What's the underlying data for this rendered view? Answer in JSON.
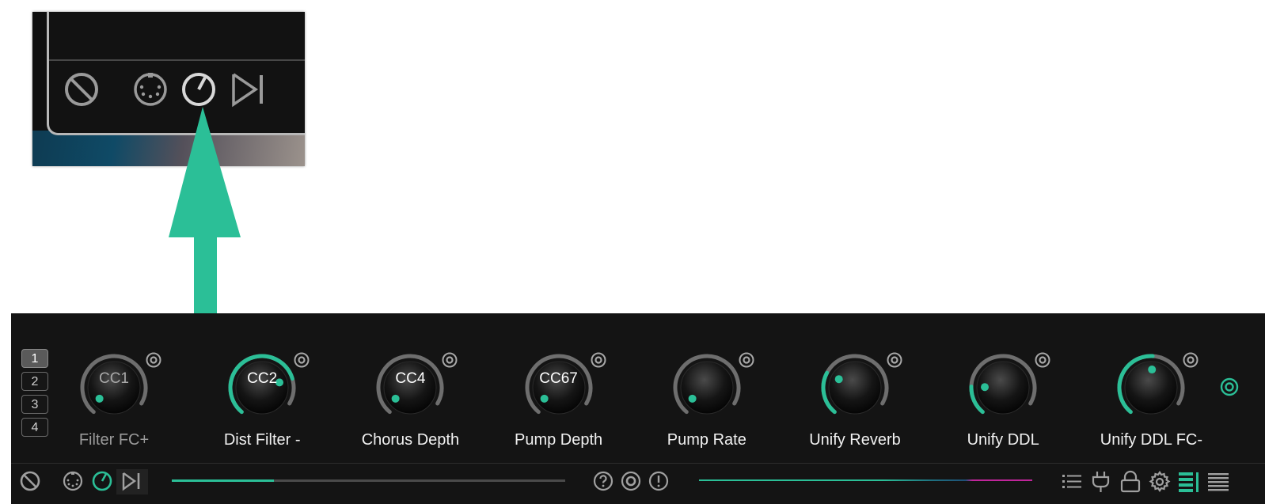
{
  "colors": {
    "accent": "#2bbf97",
    "panel": "#141414",
    "magenta": "#c0259a"
  },
  "zoom_inset": {
    "icons": [
      "disable-icon",
      "midi-icon",
      "knob-icon",
      "skip-icon"
    ]
  },
  "pages": [
    {
      "label": "1",
      "active": true
    },
    {
      "label": "2",
      "active": false
    },
    {
      "label": "3",
      "active": false
    },
    {
      "label": "4",
      "active": false
    }
  ],
  "knobs": [
    {
      "cc": "CC1",
      "label": "Filter FC+",
      "value": 0.05,
      "arc": 0,
      "dim": true
    },
    {
      "cc": "CC2",
      "label": "Dist Filter -",
      "value": 0.82,
      "arc": 0.82,
      "dim": false
    },
    {
      "cc": "CC4",
      "label": "Chorus Depth",
      "value": 0.05,
      "arc": 0,
      "dim": false
    },
    {
      "cc": "CC67",
      "label": "Pump Depth",
      "value": 0.05,
      "arc": 0,
      "dim": false
    },
    {
      "cc": "",
      "label": "Pump Rate",
      "value": 0.05,
      "arc": 0,
      "dim": false
    },
    {
      "cc": "",
      "label": "Unify Reverb",
      "value": 0.3,
      "arc": 0.3,
      "dim": false
    },
    {
      "cc": "",
      "label": "Unify DDL",
      "value": 0.2,
      "arc": 0.2,
      "dim": false
    },
    {
      "cc": "",
      "label": "Unify DDL FC-",
      "value": 0.55,
      "arc": 0.55,
      "dim": false
    }
  ],
  "toolbar": {
    "left_icons": [
      "disable-icon",
      "midi-icon",
      "knob-icon",
      "skip-icon"
    ],
    "progress": 0.26,
    "center_icons": [
      "help-icon",
      "record-icon",
      "alert-icon"
    ],
    "right_icons": [
      "list-icon",
      "plug-icon",
      "lock-icon",
      "gear-icon",
      "layout-split-icon",
      "layout-list-icon"
    ]
  }
}
